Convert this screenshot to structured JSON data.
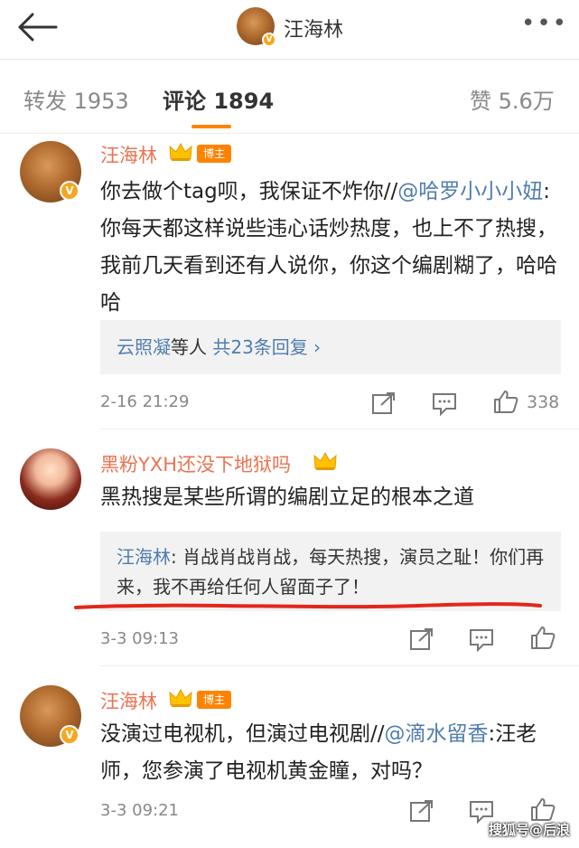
{
  "header": {
    "title": "汪海林"
  },
  "tabs": [
    {
      "label": "转发 1953"
    },
    {
      "label": "评论 1894"
    },
    {
      "label": "赞 5.6万"
    }
  ],
  "comments": [
    {
      "name": "汪海林",
      "badge": "博主",
      "text_plain": "你去做个tag呗，我保证不炸你//",
      "mention": "@哈罗小小小妞",
      "text_rest": ":你每天都这样说些违心话炒热度，也上不了热搜，我前几天看到还有人说你，你这个编剧糊了，哈哈哈",
      "reply_summary": {
        "names": "云照凝",
        "suffix": "等人",
        "link": "共23条回复 ›"
      },
      "time": "2-16 21:29",
      "likes": "338"
    },
    {
      "name": "黑粉YXH还没下地狱吗",
      "text": "黑热搜是某些所谓的编剧立足的根本之道",
      "reply": {
        "name": "汪海林",
        "text": ": 肖战肖战肖战，每天热搜，演员之耻！你们再来，我不再给任何人留面子了！"
      },
      "time": "3-3 09:13"
    },
    {
      "name": "汪海林",
      "badge": "博主",
      "text_plain": "没演过电视机，但演过电视剧//",
      "mention": "@滴水留香",
      "text_rest": ":汪老师，您参演了电视机黄金瞳，对吗？",
      "time": "3-3 09:21"
    }
  ],
  "watermark": "搜狐号@后浪"
}
